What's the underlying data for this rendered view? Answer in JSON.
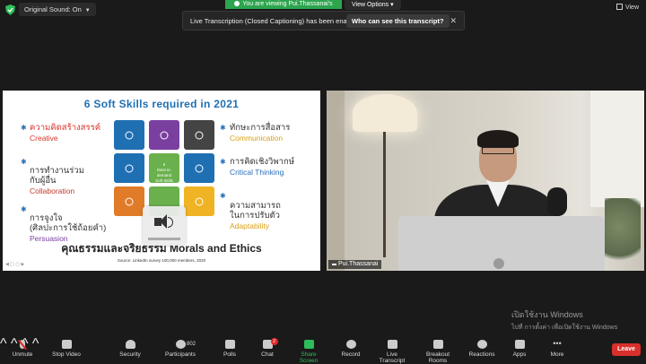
{
  "topbar": {
    "original_sound": "Original Sound: On",
    "viewing_banner": "You are viewing Pui.Thassanai's screen",
    "view_options": "View Options",
    "view_button": "View"
  },
  "transcript_banner": {
    "message": "Live Transcription (Closed Captioning) has been enabled",
    "who_button": "Who can see this transcript?",
    "close": "✕"
  },
  "slide": {
    "title": "6 Soft Skills required in 2021",
    "skills": [
      {
        "th": "ความคิดสร้างสรรค์",
        "en": "Creative"
      },
      {
        "th": "การทำงานร่วม\nกับผู้อื่น",
        "en": "Collaboration"
      },
      {
        "th": "การจูงใจ\n(ศิลปะการใช้ถ้อยคำ)",
        "en": "Persuasion"
      },
      {
        "th": "ทักษะการสื่อสาร",
        "en": "Communication"
      },
      {
        "th": "การคิดเชิงวิพากษ์",
        "en": "Critical Thinking"
      },
      {
        "th": "ความสามารถ\nในการปรับตัว",
        "en": "Adaptability"
      }
    ],
    "center_label": "6\nMost in-demand\nSoft Skills",
    "bottom_line": "คุณธรรมและจริยธรรม Morals and Ethics",
    "source": "Source: LinkedIn survey 100,000 members, 2020",
    "colors": {
      "title": "#1f6fb3",
      "creative": "#d9342b",
      "collab": "#c0392b",
      "persuasion": "#7b3fa0",
      "communication": "#d9a016",
      "critical": "#2a6fb8",
      "adapt": "#d9a016"
    }
  },
  "video": {
    "name": "Pui.Thassanai"
  },
  "activate_windows": {
    "line1": "เปิดใช้งาน Windows",
    "line2": "ไปที่ การตั้งค่า เพื่อเปิดใช้งาน Windows"
  },
  "toolbar": {
    "unmute": "Unmute",
    "stop_video": "Stop Video",
    "security": "Security",
    "participants": "Participants",
    "participants_count": "802",
    "polls": "Polls",
    "chat": "Chat",
    "chat_badge": "2",
    "share_screen": "Share Screen",
    "record": "Record",
    "live_transcript": "Live Transcript",
    "breakout_rooms": "Breakout Rooms",
    "reactions": "Reactions",
    "apps": "Apps",
    "more": "More",
    "leave": "Leave"
  }
}
